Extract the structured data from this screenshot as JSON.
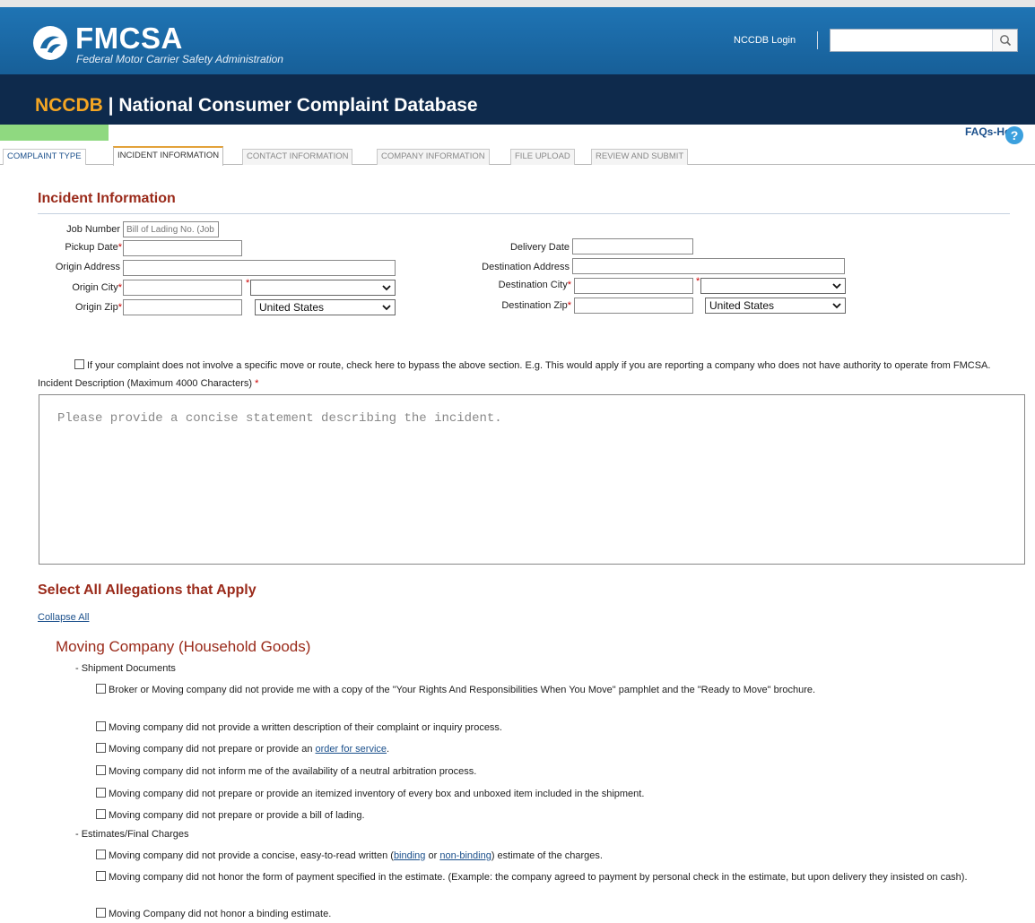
{
  "header": {
    "logo_name": "FMCSA",
    "logo_sub": "Federal Motor Carrier Safety Administration",
    "login": "NCCDB Login",
    "search_placeholder": "",
    "db_acronym": "NCCDB",
    "db_sep": " | ",
    "db_title": "National Consumer Complaint Database"
  },
  "help": {
    "label": "FAQs-Help"
  },
  "tabs": [
    {
      "label": "COMPLAINT TYPE"
    },
    {
      "label": "INCIDENT INFORMATION"
    },
    {
      "label": "CONTACT INFORMATION"
    },
    {
      "label": "COMPANY INFORMATION"
    },
    {
      "label": "FILE UPLOAD"
    },
    {
      "label": "REVIEW AND SUBMIT"
    }
  ],
  "incident": {
    "title": "Incident Information",
    "job_number_label": "Job Number",
    "job_number_placeholder": "Bill of Lading No. (Job #",
    "pickup_date_label": "Pickup Date",
    "origin_address_label": "Origin Address",
    "origin_city_label": "Origin City",
    "origin_zip_label": "Origin Zip",
    "origin_country": "United States",
    "delivery_date_label": "Delivery Date",
    "destination_address_label": "Destination Address",
    "destination_city_label": "Destination City",
    "destination_zip_label": "Destination Zip",
    "destination_country": "United States",
    "required_mark": "*",
    "bypass_text": "If your complaint does not involve a specific move or route, check here to bypass the above section. E.g. This would apply if you are reporting a company who does not have authority to operate from FMCSA.",
    "description_label": "Incident Description (Maximum 4000 Characters)",
    "description_placeholder": "Please provide a concise statement describing the incident."
  },
  "allegations": {
    "title": "Select All Allegations that Apply",
    "collapse": "Collapse All",
    "category": "Moving Company (Household Goods)",
    "group1": "- Shipment Documents",
    "group2": "- Estimates/Final Charges",
    "items1": [
      "Broker or Moving company did not provide me with a copy of the \"Your Rights And Responsibilities When You Move\" pamphlet and the \"Ready to Move\" brochure.",
      "Moving company did not provide a written description of their complaint or inquiry process.",
      "Moving company did not inform me of the availability of a neutral arbitration process.",
      "Moving company did not prepare or provide an itemized inventory of every box and unboxed item included in the shipment.",
      "Moving company did not prepare or provide a bill of lading."
    ],
    "order_item_pre": "Moving company did not prepare or provide an ",
    "order_item_link": "order for service",
    "order_item_post": ".",
    "estimate_item_pre": "Moving company did not provide a concise, easy-to-read written (",
    "estimate_item_link1": "binding",
    "estimate_item_mid": " or ",
    "estimate_item_link2": "non-binding",
    "estimate_item_post": ") estimate of the charges.",
    "payment_item": "Moving company did not honor the form of payment specified in the estimate. (Example: the company agreed to payment by personal check in the estimate, but upon delivery they insisted on cash).",
    "binding_item": "Moving Company did not honor a binding estimate."
  }
}
